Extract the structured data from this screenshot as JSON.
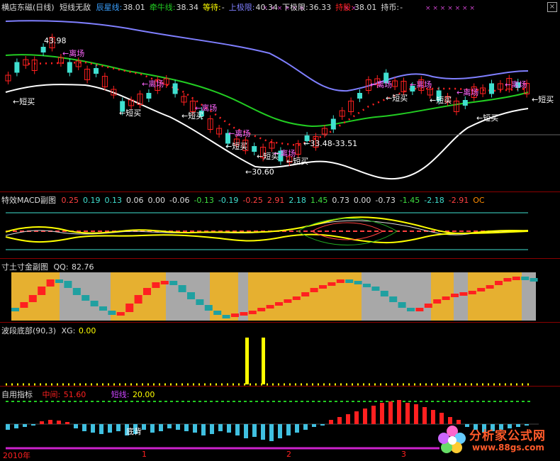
{
  "main": {
    "title": "横店东磁(日线)",
    "indicator": "短线无敌",
    "items": [
      {
        "label": "辰星线:",
        "value": "38.01",
        "color": "#3aa0ff"
      },
      {
        "label": "牵牛线:",
        "value": "38.34",
        "color": "#22cc22"
      },
      {
        "label": "等待:",
        "value": "-",
        "color": "#ffff00"
      },
      {
        "label": "上极限:",
        "value": "40.34",
        "color": "#7f7fff"
      },
      {
        "label": "下极限:",
        "value": "36.33",
        "color": "#dddddd"
      },
      {
        "label": "持股:",
        "value": "38.01",
        "color": "#ff2020"
      },
      {
        "label": "持币:",
        "value": "-",
        "color": "#dddddd"
      }
    ],
    "annotations": {
      "high": "43.98",
      "low": "30.60",
      "range": "33.48-33.51",
      "leave": "离场",
      "buy": "短买",
      "buy_left": "←短买",
      "leave_arrow": "←离场"
    }
  },
  "macd": {
    "title": "特效MACD副图",
    "values": [
      {
        "v": "0.25",
        "c": "#ff4040"
      },
      {
        "v": "0.19",
        "c": "#40e0d0"
      },
      {
        "v": "0.13",
        "c": "#40e0d0"
      },
      {
        "v": "0.06",
        "c": "#dddddd"
      },
      {
        "v": "0.00",
        "c": "#dddddd"
      },
      {
        "v": "-0.06",
        "c": "#dddddd"
      },
      {
        "v": "-0.13",
        "c": "#40e040"
      },
      {
        "v": "-0.19",
        "c": "#40e0d0"
      },
      {
        "v": "-0.25",
        "c": "#ff4040"
      },
      {
        "v": "2.91",
        "c": "#ff4040"
      },
      {
        "v": "2.18",
        "c": "#40e0d0"
      },
      {
        "v": "1.45",
        "c": "#40e040"
      },
      {
        "v": "0.73",
        "c": "#dddddd"
      },
      {
        "v": "0.00",
        "c": "#dddddd"
      },
      {
        "v": "-0.73",
        "c": "#dddddd"
      },
      {
        "v": "-1.45",
        "c": "#40e040"
      },
      {
        "v": "-2.18",
        "c": "#40e0d0"
      },
      {
        "v": "-2.91",
        "c": "#ff4040"
      },
      {
        "v": "OC",
        "c": "#ff8c00"
      }
    ]
  },
  "cun": {
    "title": "寸土寸金副图",
    "qq_label": "QQ:",
    "qq_value": "82.76"
  },
  "bodi": {
    "title": "波段底部(90,3)",
    "xg_label": "XG:",
    "xg_value": "0.00"
  },
  "custom": {
    "title": "自用指标",
    "mid_label": "中间:",
    "mid_value": "51.60",
    "short_label": "短线:",
    "short_value": "20.00",
    "note": "底背"
  },
  "xaxis": {
    "labels": [
      "2010年",
      "1",
      "2",
      "3"
    ]
  },
  "watermark": {
    "text": "分析家公式网",
    "url": "www.88gs.com"
  },
  "colors": {
    "up": "#ff2020",
    "down": "#40e0d0",
    "upper": "#7f7fff",
    "lower": "#ffffff",
    "mid": "#22cc22",
    "gold": "#e6b030",
    "gray": "#a8a8a8"
  }
}
